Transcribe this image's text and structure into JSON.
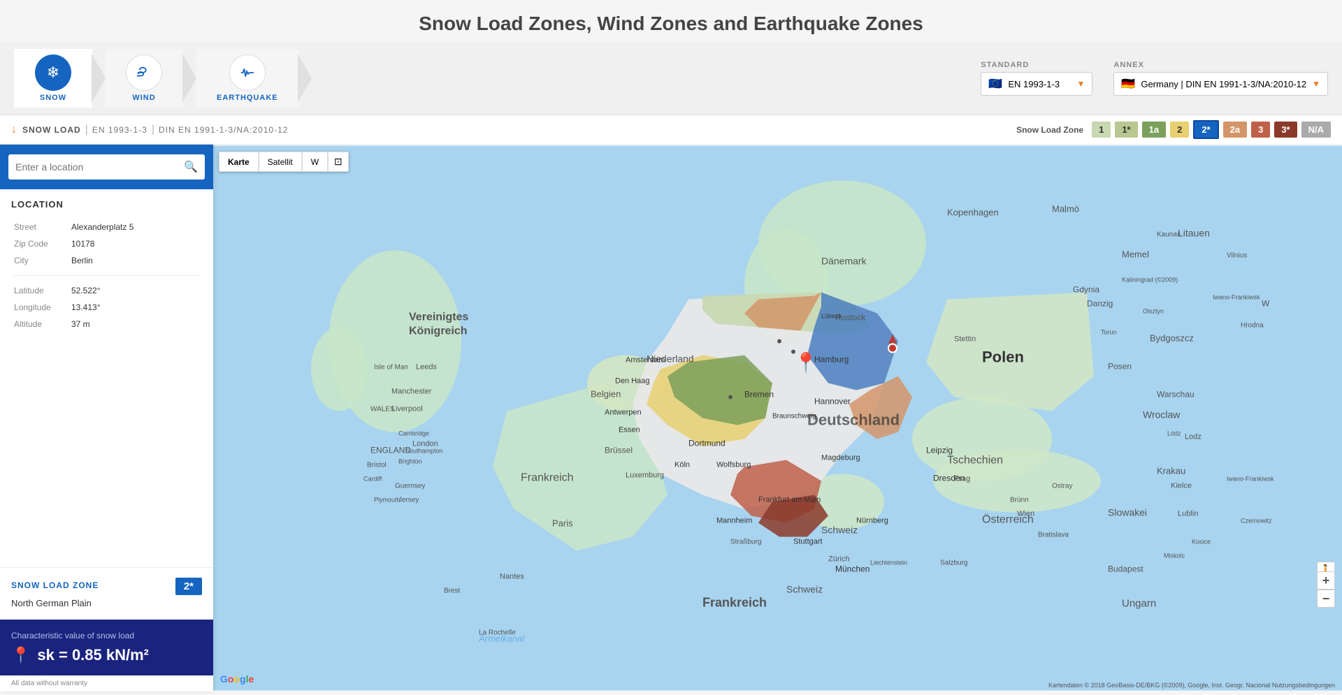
{
  "header": {
    "title": "Snow Load Zones, Wind Zones and Earthquake Zones"
  },
  "nav": {
    "items": [
      {
        "id": "snow",
        "label": "SNOW",
        "icon": "❄",
        "active": true
      },
      {
        "id": "wind",
        "label": "WIND",
        "icon": "⇌",
        "active": false
      },
      {
        "id": "earthquake",
        "label": "EARTHQUAKE",
        "icon": "📶",
        "active": false
      }
    ],
    "standard_label": "STANDARD",
    "annex_label": "ANNEX",
    "standard_value": "EN 1993-1-3",
    "annex_value": "Germany | DIN EN 1991-1-3/NA:2010-12"
  },
  "breadcrumb": {
    "icon": "↓",
    "type": "SNOW LOAD",
    "sep1": "|",
    "standard": "EN 1993-1-3",
    "sep2": "|",
    "annex": "DIN EN 1991-1-3/NA:2010-12",
    "zone_label": "Snow Load Zone"
  },
  "zones": [
    {
      "id": "1",
      "label": "1",
      "class": "zone-1"
    },
    {
      "id": "1s",
      "label": "1*",
      "class": "zone-1s"
    },
    {
      "id": "1a",
      "label": "1a",
      "class": "zone-1a"
    },
    {
      "id": "2",
      "label": "2",
      "class": "zone-2"
    },
    {
      "id": "2s",
      "label": "2*",
      "class": "zone-2s"
    },
    {
      "id": "2a",
      "label": "2a",
      "class": "zone-2a"
    },
    {
      "id": "3",
      "label": "3",
      "class": "zone-3"
    },
    {
      "id": "3s",
      "label": "3*",
      "class": "zone-3s"
    },
    {
      "id": "na",
      "label": "N/A",
      "class": "zone-na"
    }
  ],
  "search": {
    "placeholder": "Enter a location"
  },
  "location": {
    "title": "LOCATION",
    "fields": [
      {
        "label": "Street",
        "value": "Alexanderplatz 5"
      },
      {
        "label": "Zip Code",
        "value": "10178"
      },
      {
        "label": "City",
        "value": "Berlin"
      }
    ],
    "coords": [
      {
        "label": "Latitude",
        "value": "52.522°"
      },
      {
        "label": "Longitude",
        "value": "13.413°"
      },
      {
        "label": "Altitude",
        "value": "37 m"
      }
    ]
  },
  "snow_zone": {
    "title": "SNOW LOAD ZONE",
    "zone": "2*",
    "zone_name": "North German Plain",
    "char_label": "Characteristic value of snow load",
    "formula": "sk = 0.85 kN/m²",
    "formula_prefix": "sk =",
    "formula_value": "0.85 kN/m²",
    "warranty": "All data without warranty"
  },
  "map": {
    "type_buttons": [
      "Karte",
      "Satellit",
      "W"
    ],
    "screen_btn": "⊡",
    "zoom_in": "+",
    "zoom_out": "−",
    "google_logo": "Google",
    "attribution": "Kartendaten © 2018 GeoBasis-DE/BKG (©2009), Google, Inst. Geogr. Nacional  Nutzungsbedingungen"
  }
}
